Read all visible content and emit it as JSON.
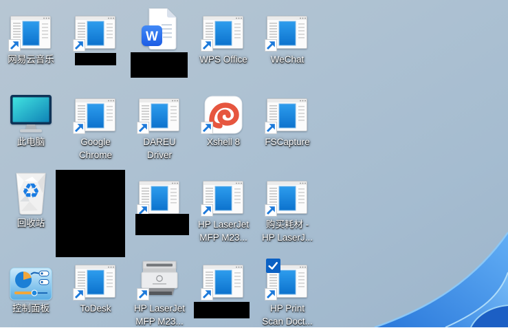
{
  "desktop": {
    "environment": "Windows 11 desktop",
    "wallpaper": {
      "base_color": "#aabfd2",
      "bloom_blue": "#3c8ce9",
      "bloom_highlight": "#9bd2f9",
      "bloom_dark": "#1c5fc4"
    },
    "icons": [
      {
        "id": "netease-cloud-music",
        "label": "网易云音乐",
        "icon": "app-window",
        "shortcut": true
      },
      {
        "id": "redacted-app-1",
        "label": "",
        "icon": "app-window",
        "shortcut": true,
        "redacted_label": true
      },
      {
        "id": "word-document",
        "label": "",
        "icon": "word-doc",
        "shortcut": false,
        "redacted_label": true
      },
      {
        "id": "wps-office",
        "label": "WPS Office",
        "icon": "app-window",
        "shortcut": true
      },
      {
        "id": "wechat",
        "label": "WeChat",
        "icon": "app-window",
        "shortcut": true
      },
      {
        "id": "this-pc",
        "label": "此电脑",
        "icon": "monitor",
        "shortcut": false
      },
      {
        "id": "google-chrome",
        "label": "Google\nChrome",
        "icon": "app-window",
        "shortcut": true
      },
      {
        "id": "dareu-driver",
        "label": "DAREU\nDriver",
        "icon": "app-window",
        "shortcut": true
      },
      {
        "id": "xshell-8",
        "label": "Xshell 8",
        "icon": "xshell",
        "shortcut": true
      },
      {
        "id": "fscapture",
        "label": "FSCapture",
        "icon": "app-window",
        "shortcut": true
      },
      {
        "id": "recycle-bin",
        "label": "回收站",
        "icon": "recycle-bin",
        "shortcut": false
      },
      {
        "id": "redacted-item",
        "label": "",
        "icon": "redacted",
        "shortcut": false,
        "redacted_full": true
      },
      {
        "id": "redacted-app-2",
        "label": "",
        "icon": "app-window",
        "shortcut": true,
        "redacted_label": true
      },
      {
        "id": "hp-laserjet-mfp-shortcut",
        "label": "HP LaserJet\nMFP M23...",
        "icon": "app-window",
        "shortcut": true
      },
      {
        "id": "buy-supplies-hp-laserjet",
        "label": "购买耗材 -\nHP LaserJ...",
        "icon": "app-window",
        "shortcut": true
      },
      {
        "id": "control-panel",
        "label": "控制面板",
        "icon": "control-panel",
        "shortcut": false
      },
      {
        "id": "todesk",
        "label": "ToDesk",
        "icon": "app-window",
        "shortcut": true
      },
      {
        "id": "hp-laserjet-mfp-printer",
        "label": "HP LaserJet\nMFP M23...",
        "icon": "printer",
        "shortcut": true
      },
      {
        "id": "redacted-app-3",
        "label": "",
        "icon": "app-window",
        "shortcut": true,
        "redacted_label": true
      },
      {
        "id": "hp-print-scan-doctor",
        "label": "HP Print\nScan Doct...",
        "icon": "app-window",
        "shortcut": true,
        "checked": true
      }
    ]
  }
}
